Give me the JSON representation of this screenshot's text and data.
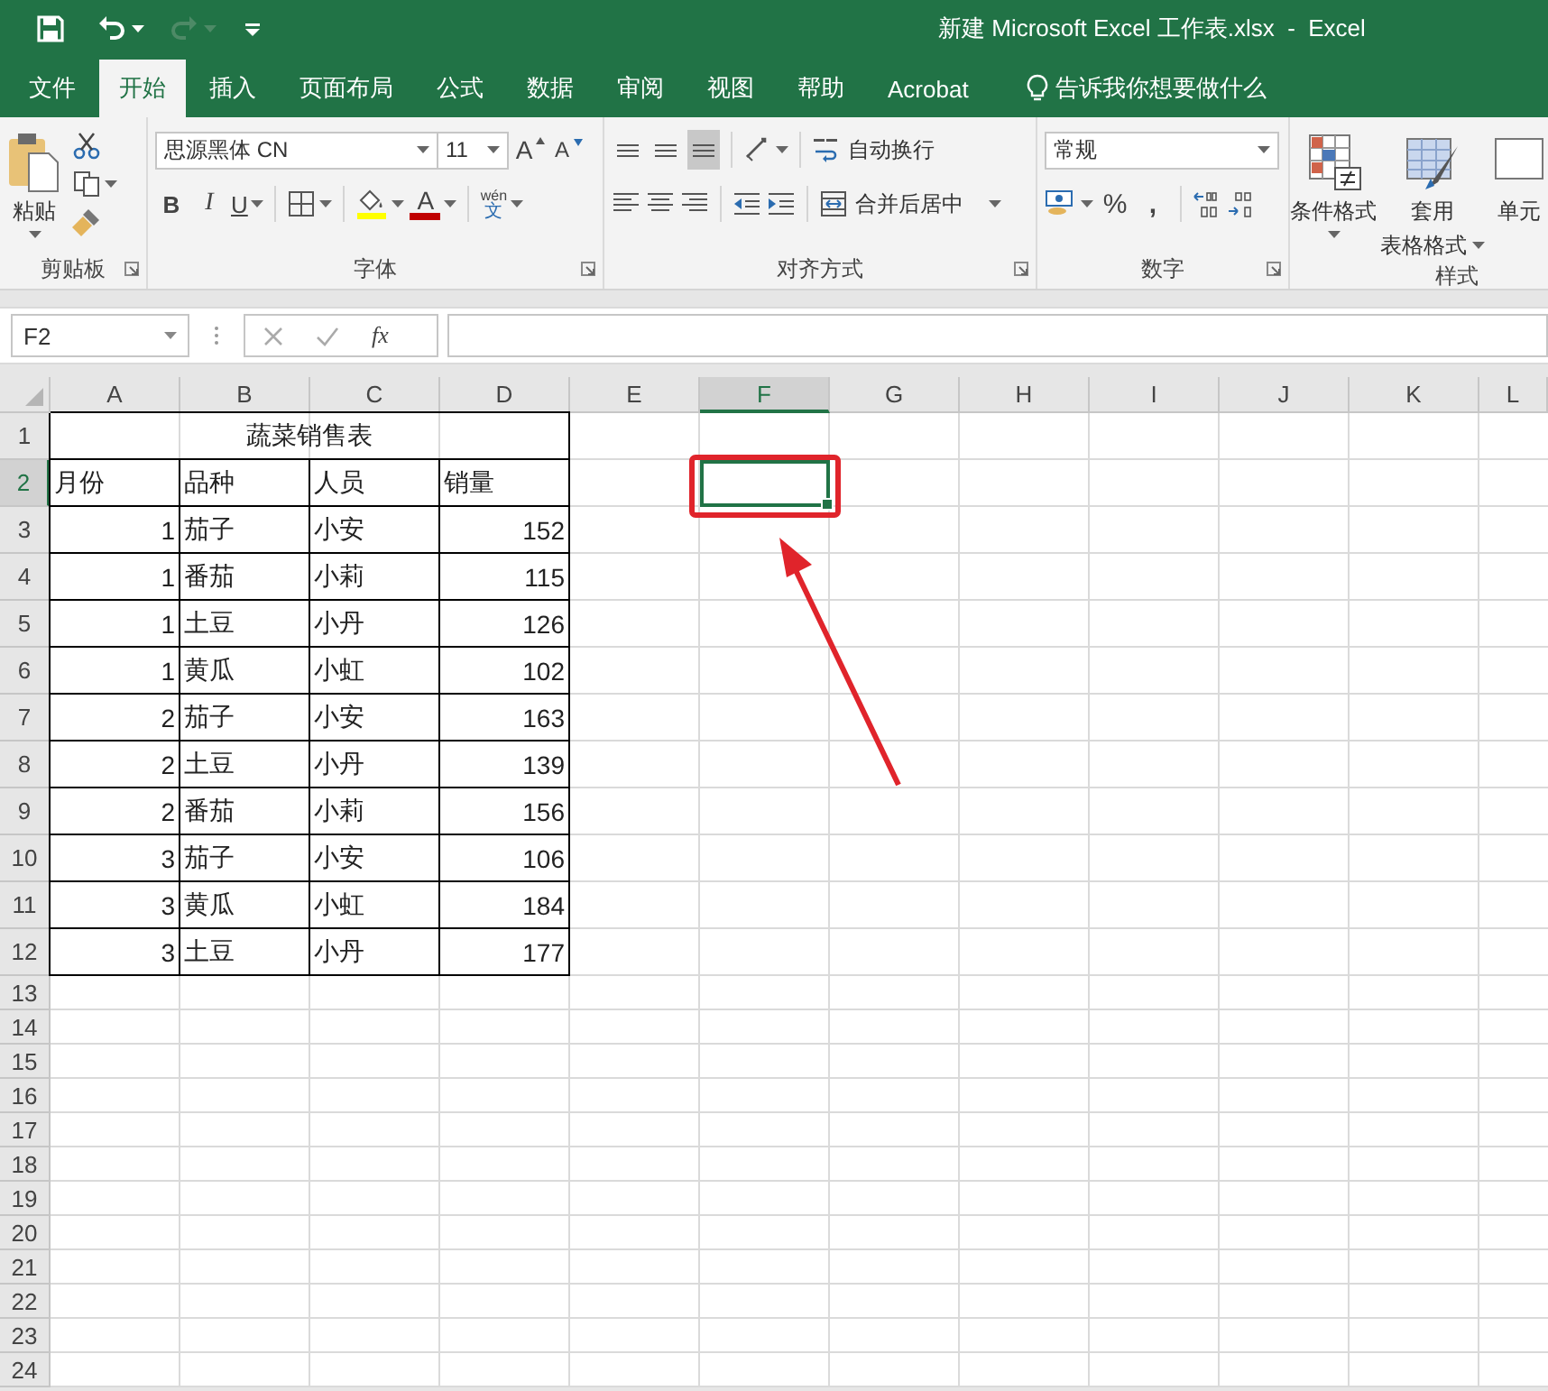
{
  "title_bar": {
    "title": "新建 Microsoft Excel 工作表.xlsx  -  Excel",
    "redo_disabled": true
  },
  "ribbon_tabs": [
    {
      "label": "文件",
      "selected": false
    },
    {
      "label": "开始",
      "selected": true
    },
    {
      "label": "插入",
      "selected": false
    },
    {
      "label": "页面布局",
      "selected": false
    },
    {
      "label": "公式",
      "selected": false
    },
    {
      "label": "数据",
      "selected": false
    },
    {
      "label": "审阅",
      "selected": false
    },
    {
      "label": "视图",
      "selected": false
    },
    {
      "label": "帮助",
      "selected": false
    },
    {
      "label": "Acrobat",
      "selected": false
    }
  ],
  "tell_me": "告诉我你想要做什么",
  "clipboard": {
    "paste": "粘贴",
    "group_label": "剪贴板"
  },
  "font": {
    "name": "思源黑体 CN",
    "size": "11",
    "grow": "A",
    "shrink": "A",
    "bold": "B",
    "italic": "I",
    "underline": "U",
    "font_color": "A",
    "phonetic_top": "wén",
    "phonetic_char": "文",
    "group_label": "字体"
  },
  "alignment": {
    "vertical_align": [
      {
        "selected": false
      },
      {
        "selected": false
      },
      {
        "selected": true
      }
    ],
    "wrap_text": "自动换行",
    "merge_center": "合并后居中",
    "group_label": "对齐方式"
  },
  "number": {
    "format": "常规",
    "percent": "%",
    "comma": ",",
    "group_label": "数字"
  },
  "styles": {
    "conditional": "条件格式",
    "table_format_top": "套用",
    "table_format_bottom": "表格格式",
    "cell_styles": "单元",
    "group_label": "样式"
  },
  "formula_bar": {
    "name_box": "F2",
    "function_label": "fx"
  },
  "sheet": {
    "columns": [
      {
        "label": "A",
        "selected": false
      },
      {
        "label": "B",
        "selected": false
      },
      {
        "label": "C",
        "selected": false
      },
      {
        "label": "D",
        "selected": false
      },
      {
        "label": "E",
        "selected": false
      },
      {
        "label": "F",
        "selected": true
      },
      {
        "label": "G",
        "selected": false
      },
      {
        "label": "H",
        "selected": false
      },
      {
        "label": "I",
        "selected": false
      },
      {
        "label": "J",
        "selected": false
      },
      {
        "label": "K",
        "selected": false
      },
      {
        "label": "L",
        "selected": false
      }
    ],
    "rows": [
      {
        "label": "1",
        "selected": false
      },
      {
        "label": "2",
        "selected": true
      },
      {
        "label": "3",
        "selected": false
      },
      {
        "label": "4",
        "selected": false
      },
      {
        "label": "5",
        "selected": false
      },
      {
        "label": "6",
        "selected": false
      },
      {
        "label": "7",
        "selected": false
      },
      {
        "label": "8",
        "selected": false
      },
      {
        "label": "9",
        "selected": false
      },
      {
        "label": "10",
        "selected": false
      },
      {
        "label": "11",
        "selected": false
      },
      {
        "label": "12",
        "selected": false
      },
      {
        "label": "13",
        "selected": false
      },
      {
        "label": "14",
        "selected": false
      },
      {
        "label": "15",
        "selected": false
      },
      {
        "label": "16",
        "selected": false
      },
      {
        "label": "17",
        "selected": false
      },
      {
        "label": "18",
        "selected": false
      },
      {
        "label": "19",
        "selected": false
      },
      {
        "label": "20",
        "selected": false
      },
      {
        "label": "21",
        "selected": false
      },
      {
        "label": "22",
        "selected": false
      },
      {
        "label": "23",
        "selected": false
      },
      {
        "label": "24",
        "selected": false
      }
    ],
    "table_title": "蔬菜销售表",
    "table_header": [
      {
        "label": "月份",
        "kind": "number"
      },
      {
        "label": "品种",
        "kind": "text"
      },
      {
        "label": "人员",
        "kind": "text"
      },
      {
        "label": "销量",
        "kind": "number"
      }
    ],
    "table_rows": [
      [
        "1",
        "茄子",
        "小安",
        "152"
      ],
      [
        "1",
        "番茄",
        "小莉",
        "115"
      ],
      [
        "1",
        "土豆",
        "小丹",
        "126"
      ],
      [
        "1",
        "黄瓜",
        "小虹",
        "102"
      ],
      [
        "2",
        "茄子",
        "小安",
        "163"
      ],
      [
        "2",
        "土豆",
        "小丹",
        "139"
      ],
      [
        "2",
        "番茄",
        "小莉",
        "156"
      ],
      [
        "3",
        "茄子",
        "小安",
        "106"
      ],
      [
        "3",
        "黄瓜",
        "小虹",
        "184"
      ],
      [
        "3",
        "土豆",
        "小丹",
        "177"
      ]
    ]
  }
}
